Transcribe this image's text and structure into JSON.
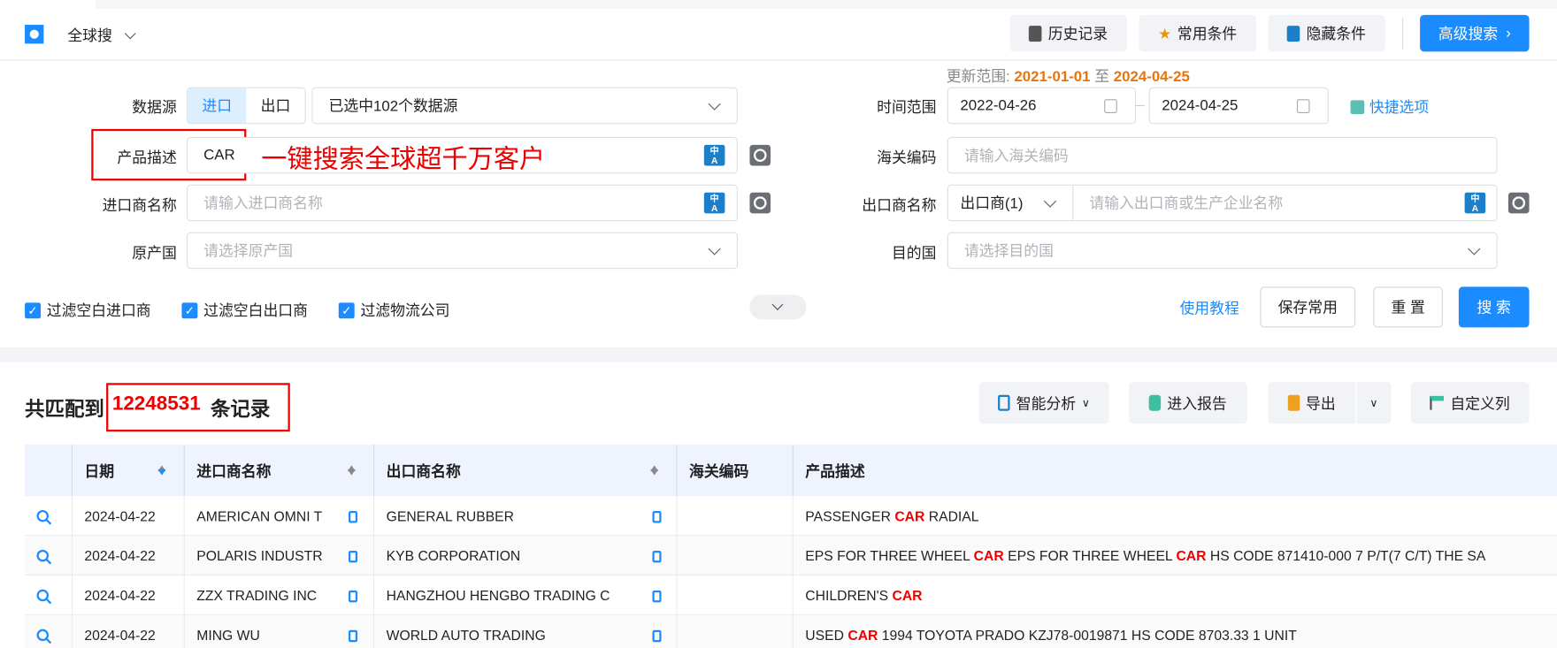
{
  "header": {
    "app_name": "全球搜",
    "buttons": {
      "history": "历史记录",
      "common": "常用条件",
      "hide": "隐藏条件",
      "advanced": "高级搜索"
    }
  },
  "update_range": {
    "label": "更新范围:",
    "start": "2021-01-01",
    "sep": "至",
    "end": "2024-04-25"
  },
  "form": {
    "data_source": {
      "label": "数据源",
      "import": "进口",
      "export": "出口",
      "selected": "已选中102个数据源"
    },
    "product": {
      "label": "产品描述",
      "value": "CAR",
      "overlay": "一键搜索全球超千万客户"
    },
    "importer": {
      "label": "进口商名称",
      "placeholder": "请输入进口商名称"
    },
    "origin": {
      "label": "原产国",
      "placeholder": "请选择原产国"
    },
    "time": {
      "label": "时间范围",
      "from": "2022-04-26",
      "to": "2024-04-25",
      "quick": "快捷选项"
    },
    "hs": {
      "label": "海关编码",
      "placeholder": "请输入海关编码"
    },
    "exporter": {
      "label": "出口商名称",
      "type": "出口商(1)",
      "placeholder": "请输入出口商或生产企业名称"
    },
    "dest": {
      "label": "目的国",
      "placeholder": "请选择目的国"
    },
    "filters": [
      "过滤空白进口商",
      "过滤空白出口商",
      "过滤物流公司"
    ],
    "tutorial": "使用教程",
    "save": "保存常用",
    "reset": "重 置",
    "search": "搜 索"
  },
  "results": {
    "prefix": "共匹配到",
    "count": "12248531",
    "suffix": "条记录",
    "buttons": {
      "analysis": "智能分析",
      "report": "进入报告",
      "export": "导出",
      "columns": "自定义列"
    }
  },
  "table": {
    "headers": [
      "日期",
      "进口商名称",
      "出口商名称",
      "海关编码",
      "产品描述"
    ],
    "rows": [
      {
        "date": "2024-04-22",
        "importer": "AMERICAN OMNI T",
        "exporter": "GENERAL RUBBER",
        "hs": "",
        "desc": [
          "PASSENGER ",
          "CAR",
          " RADIAL"
        ]
      },
      {
        "date": "2024-04-22",
        "importer": "POLARIS INDUSTR",
        "exporter": "KYB CORPORATION",
        "hs": "",
        "desc": [
          "EPS FOR THREE WHEEL ",
          "CAR",
          " EPS FOR THREE WHEEL ",
          "CAR",
          " HS CODE 871410-000 7 P/T(7 C/T) THE SA"
        ]
      },
      {
        "date": "2024-04-22",
        "importer": "ZZX TRADING INC",
        "exporter": "HANGZHOU HENGBO TRADING C",
        "hs": "",
        "desc": [
          "CHILDREN'S ",
          "CAR"
        ]
      },
      {
        "date": "2024-04-22",
        "importer": "MING WU",
        "exporter": "WORLD AUTO TRADING",
        "hs": "",
        "desc": [
          "USED ",
          "CAR",
          " 1994 TOYOTA PRADO KZJ78-0019871 HS CODE 8703.33 1 UNIT"
        ]
      }
    ]
  },
  "colors": {
    "accent": "#1a8cff",
    "highlight": "#ee0000",
    "orange": "#e8740c"
  }
}
